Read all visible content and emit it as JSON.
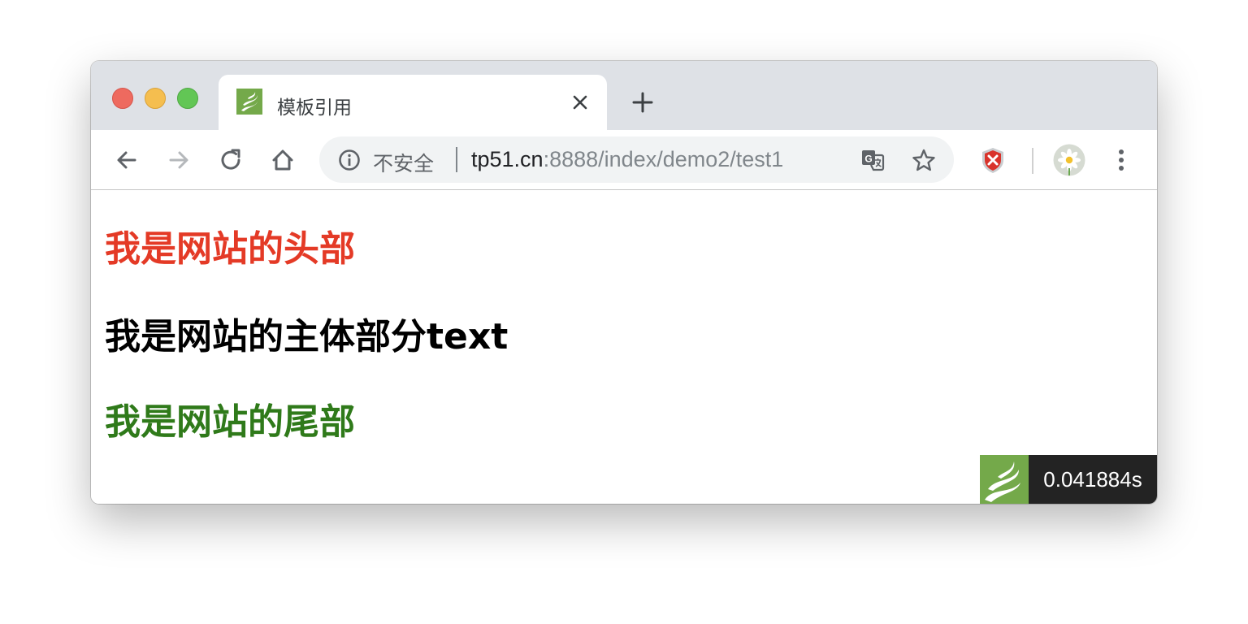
{
  "tab": {
    "title": "模板引用"
  },
  "address_bar": {
    "security_label": "不安全",
    "url_host": "tp51.cn",
    "url_rest": ":8888/index/demo2/test1"
  },
  "icons": {
    "back": "arrow-left",
    "forward": "arrow-right",
    "reload": "reload",
    "home": "home",
    "info": "info-circle",
    "translate": "google-translate",
    "bookmark": "star-outline",
    "extension": "red-shield-x",
    "menu": "vertical-dots"
  },
  "content": {
    "header_text": "我是网站的头部",
    "body_text": "我是网站的主体部分text",
    "footer_text": "我是网站的尾部"
  },
  "trace": {
    "time": "0.041884s"
  },
  "colors": {
    "header": "#e43a26",
    "body": "#000000",
    "footer": "#2f7a1a",
    "tabbar": "#dee1e6",
    "thinkphp_green": "#74a94a",
    "trace_bg": "#232323"
  }
}
